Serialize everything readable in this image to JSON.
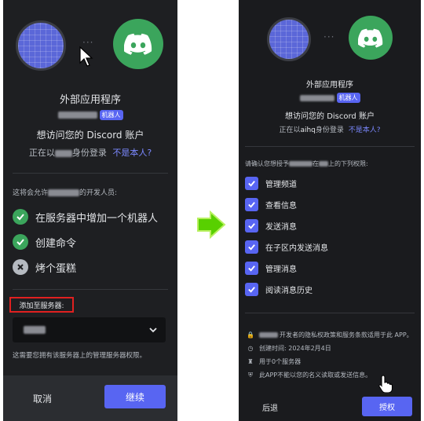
{
  "left": {
    "dots": "···",
    "title": "外部应用程序",
    "bot_badge": "机器人",
    "wants_access": "想访问您的 Discord 账户",
    "logged_in_prefix": "正在以",
    "logged_in_suffix": "身份登录",
    "not_you": "不是本人?",
    "permits_prefix": "这将会允许",
    "permits_suffix": "的开发人员:",
    "permissions": [
      {
        "label": "在服务器中增加一个机器人",
        "icon": "check-icon"
      },
      {
        "label": "创建命令",
        "icon": "check-icon"
      },
      {
        "label": "烤个蛋糕",
        "icon": "x-icon"
      }
    ],
    "add_to_server_label": "添加至服务器:",
    "server_note": "这需要您拥有该服务器上的管理服务器权限。",
    "cancel": "取消",
    "continue": "继续"
  },
  "right": {
    "title": "外部应用程序",
    "bot_badge": "机器人",
    "wants_access": "想访问您的 Discord 账户",
    "logged_in_prefix": "正在以",
    "username": "aihq",
    "logged_in_suffix": "身份登录",
    "not_you": "不是本人?",
    "confirm_prefix": "请确认您想授予",
    "confirm_mid": "在",
    "confirm_suffix": "上的下列权限:",
    "permissions": [
      "管理频道",
      "查看信息",
      "发送消息",
      "在子区内发送消息",
      "管理消息",
      "阅读消息历史"
    ],
    "info": [
      {
        "icon": "lock-icon",
        "text": "开发者的隐私权政策和服务条款适用于此 APP。"
      },
      {
        "icon": "clock-icon",
        "text": "创建时间: 2024年2月4日"
      },
      {
        "icon": "server-icon",
        "text": "用于0个服务器"
      },
      {
        "icon": "shield-icon",
        "text": "此APP不能以您的名义读取或发送信息。"
      }
    ],
    "back": "后退",
    "authorize": "授权"
  },
  "colors": {
    "accent": "#5865f2",
    "success": "#3ba55c",
    "highlight": "#e02020",
    "arrow": "#58d000"
  }
}
